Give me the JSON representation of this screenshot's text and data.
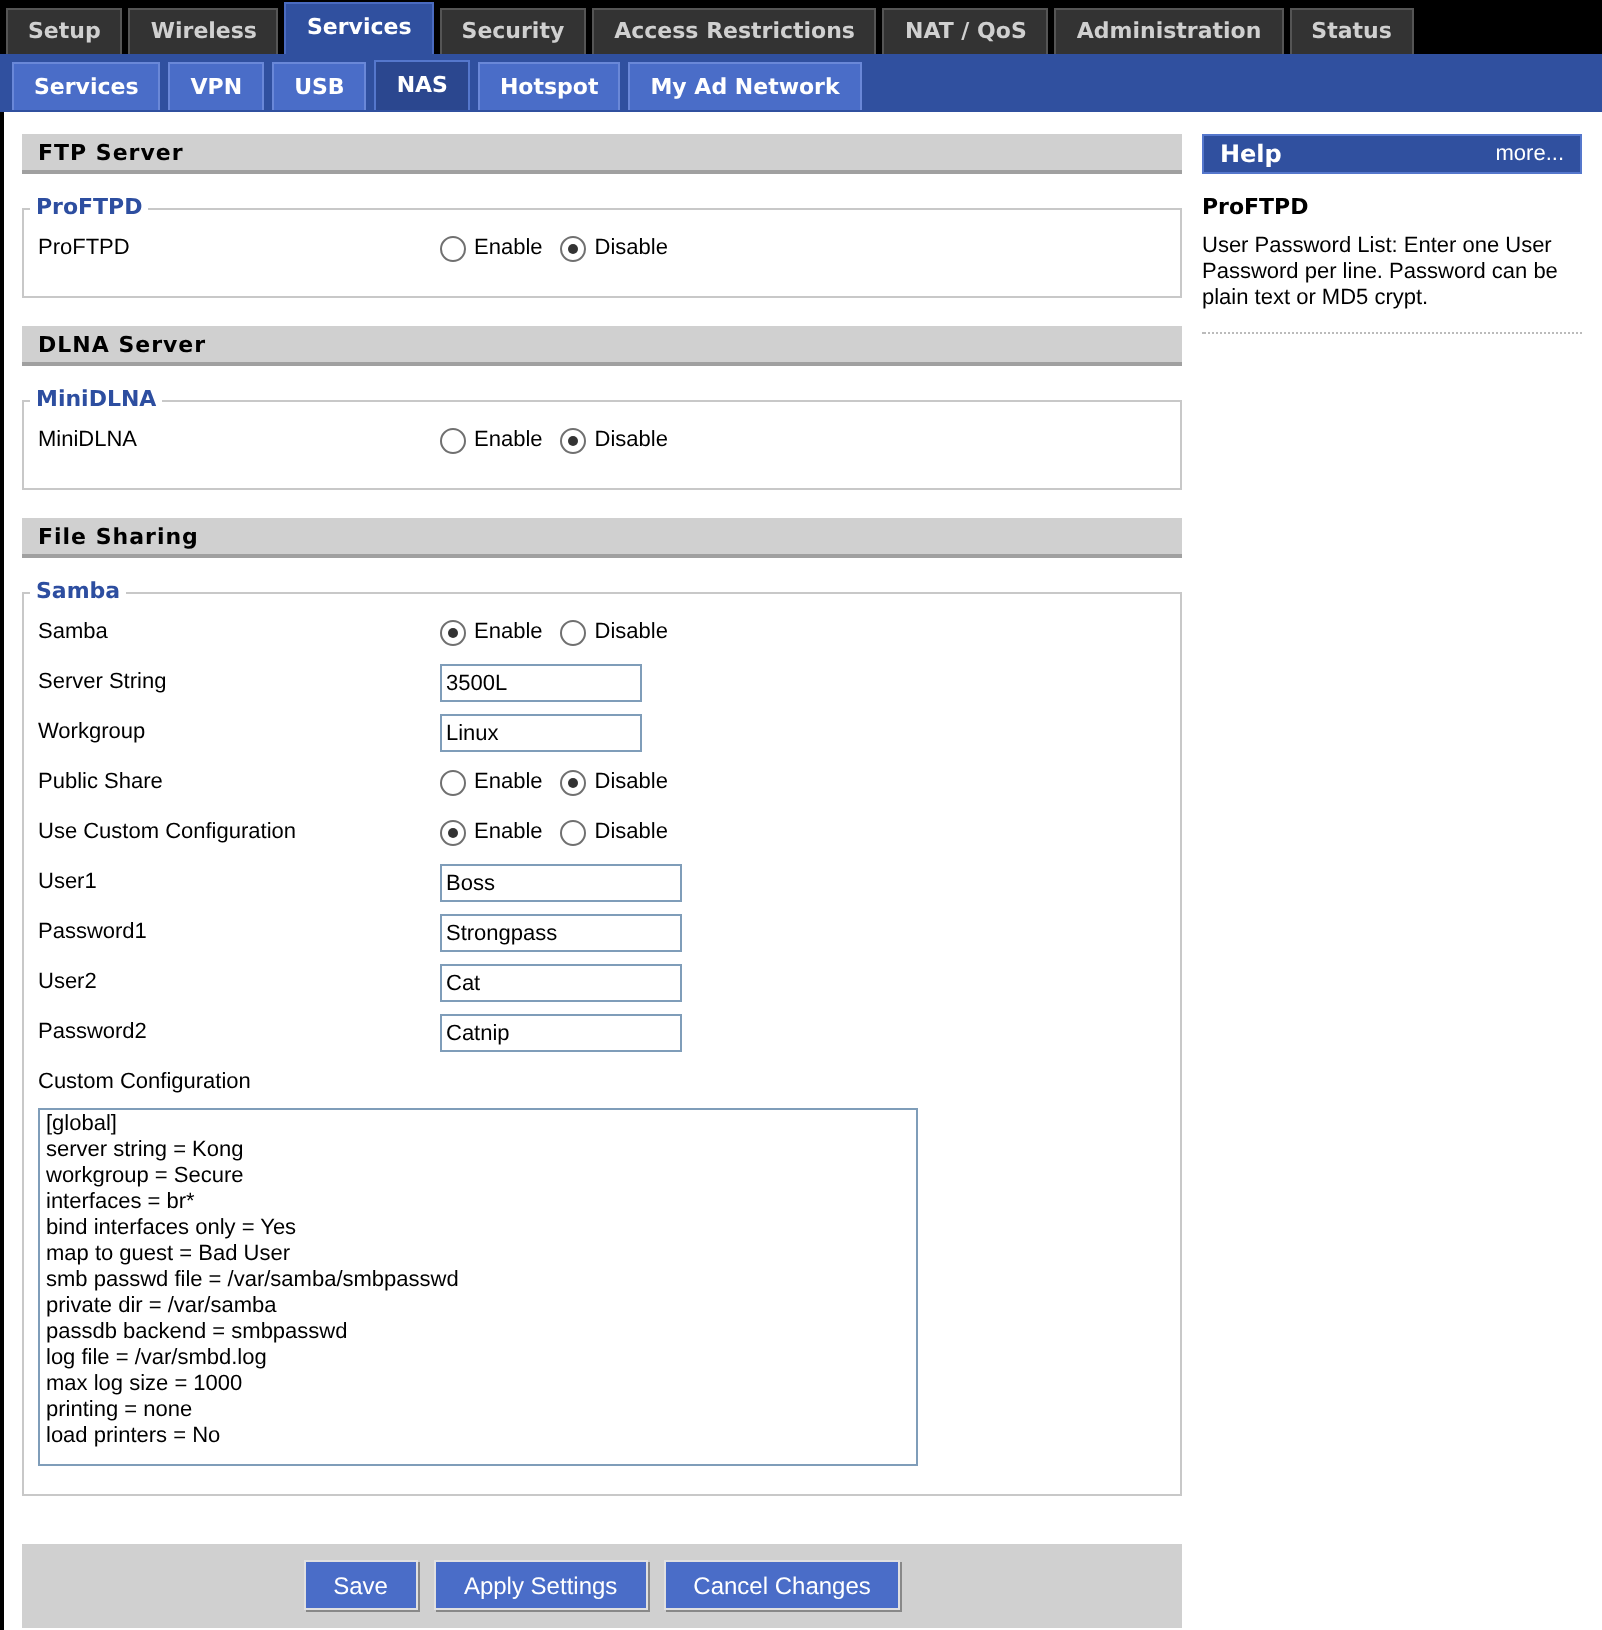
{
  "main_tabs": [
    {
      "label": "Setup",
      "selected": false
    },
    {
      "label": "Wireless",
      "selected": false
    },
    {
      "label": "Services",
      "selected": true
    },
    {
      "label": "Security",
      "selected": false
    },
    {
      "label": "Access Restrictions",
      "selected": false
    },
    {
      "label": "NAT / QoS",
      "selected": false
    },
    {
      "label": "Administration",
      "selected": false
    },
    {
      "label": "Status",
      "selected": false
    }
  ],
  "sub_tabs": [
    {
      "label": "Services",
      "selected": false
    },
    {
      "label": "VPN",
      "selected": false
    },
    {
      "label": "USB",
      "selected": false
    },
    {
      "label": "NAS",
      "selected": true
    },
    {
      "label": "Hotspot",
      "selected": false
    },
    {
      "label": "My Ad Network",
      "selected": false
    }
  ],
  "sections": [
    {
      "title": "FTP Server",
      "fieldset": {
        "legend": "ProFTPD",
        "rows": [
          {
            "kind": "radio",
            "label": "ProFTPD",
            "options": [
              {
                "label": "Enable",
                "selected": false
              },
              {
                "label": "Disable",
                "selected": true
              }
            ]
          }
        ]
      }
    },
    {
      "title": "DLNA Server",
      "fieldset": {
        "legend": "MiniDLNA",
        "rows": [
          {
            "kind": "radio",
            "label": "MiniDLNA",
            "options": [
              {
                "label": "Enable",
                "selected": false
              },
              {
                "label": "Disable",
                "selected": true
              }
            ]
          }
        ]
      }
    },
    {
      "title": "File Sharing",
      "fieldset": {
        "legend": "Samba",
        "rows": [
          {
            "kind": "radio",
            "label": "Samba",
            "options": [
              {
                "label": "Enable",
                "selected": true
              },
              {
                "label": "Disable",
                "selected": false
              }
            ]
          },
          {
            "kind": "text",
            "label": "Server String",
            "value": "3500L"
          },
          {
            "kind": "text",
            "label": "Workgroup",
            "value": "Linux"
          },
          {
            "kind": "radio",
            "label": "Public Share",
            "options": [
              {
                "label": "Enable",
                "selected": false
              },
              {
                "label": "Disable",
                "selected": true
              }
            ]
          },
          {
            "kind": "radio",
            "label": "Use Custom Configuration",
            "options": [
              {
                "label": "Enable",
                "selected": true
              },
              {
                "label": "Disable",
                "selected": false
              }
            ]
          },
          {
            "kind": "wide",
            "label": "User1",
            "value": "Boss"
          },
          {
            "kind": "wide",
            "label": "Password1",
            "value": "Strongpass"
          },
          {
            "kind": "wide",
            "label": "User2",
            "value": "Cat"
          },
          {
            "kind": "wide",
            "label": "Password2",
            "value": "Catnip"
          },
          {
            "kind": "textarea",
            "label": "Custom Configuration",
            "lines": [
              "[global]",
              "server string = Kong",
              "workgroup = Secure",
              "interfaces = br*",
              "bind interfaces only = Yes",
              "map to guest = Bad User",
              "smb passwd file = /var/samba/smbpasswd",
              "private dir = /var/samba",
              "passdb backend = smbpasswd",
              "log file = /var/smbd.log",
              "max log size = 1000",
              "printing = none",
              "load printers = No"
            ]
          }
        ]
      }
    }
  ],
  "buttons": [
    "Save",
    "Apply Settings",
    "Cancel Changes"
  ],
  "help": {
    "title": "Help",
    "more": "more...",
    "heading": "ProFTPD",
    "text": "User Password List: Enter one User Password per line. Password can be plain text or MD5 crypt."
  }
}
